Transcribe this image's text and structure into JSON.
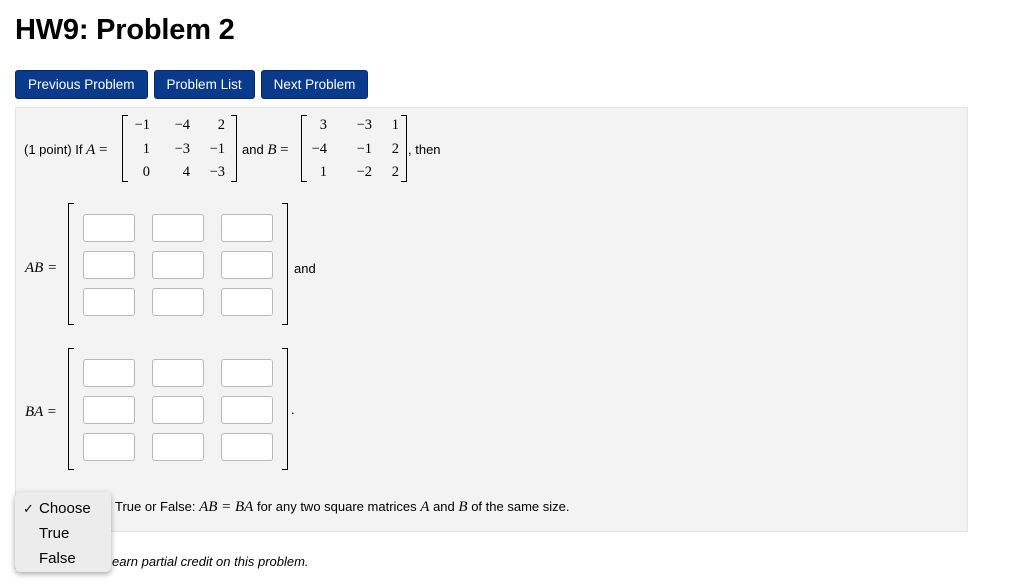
{
  "page": {
    "title": "HW9: Problem 2"
  },
  "nav": {
    "prev": "Previous Problem",
    "list": "Problem List",
    "next": "Next Problem"
  },
  "problem": {
    "intro": "(1 point) If",
    "var_A": "A",
    "eq": "=",
    "and_text": "and",
    "var_B": "B",
    "then_text": ", then",
    "matrix_A": [
      [
        "−1",
        "−4",
        "2"
      ],
      [
        "1",
        "−3",
        "−1"
      ],
      [
        "0",
        "4",
        "−3"
      ]
    ],
    "matrix_B": [
      [
        "3",
        "−3",
        "1"
      ],
      [
        "−4",
        "−1",
        "2"
      ],
      [
        "1",
        "−2",
        "2"
      ]
    ],
    "ab_label": "AB =",
    "ab_after": "and",
    "ba_label": "BA =",
    "ba_after": "."
  },
  "tf": {
    "text_pre": "True or False:",
    "math": "AB = BA",
    "text_mid": "for any two square matrices",
    "var_a": "A",
    "and": "and",
    "var_b": "B",
    "text_post": "of the same size."
  },
  "dropdown": {
    "options": [
      "Choose",
      "True",
      "False"
    ],
    "checked_index": 0
  },
  "partial_credit": "earn partial credit on this problem."
}
